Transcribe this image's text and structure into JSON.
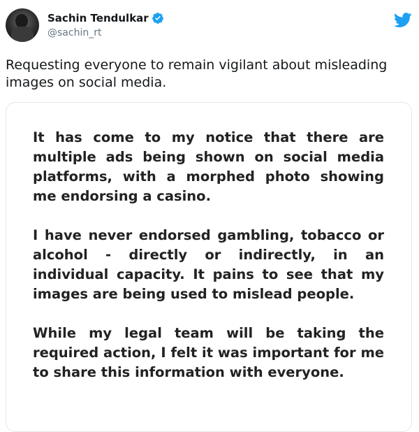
{
  "author": {
    "display_name": "Sachin Tendulkar",
    "handle": "@sachin_rt",
    "verified": true,
    "verified_icon": "verified-badge-icon",
    "avatar_icon": "profile-avatar"
  },
  "brand": {
    "icon": "twitter-bird-icon",
    "accent_color": "#1da1f2"
  },
  "tweet": {
    "text": "Requesting everyone to remain vigilant about misleading images on social media."
  },
  "statement": {
    "paragraphs": [
      "It has come to my notice that there are multiple ads being shown on social media platforms, with a morphed photo showing me endorsing a casino.",
      "I have never endorsed gambling, tobacco or alcohol - directly or indirectly, in an individual capacity. It pains to see that my images are being used to mislead people.",
      "While my legal team will be taking the required action, I felt it was important for me to share this information with everyone."
    ]
  }
}
